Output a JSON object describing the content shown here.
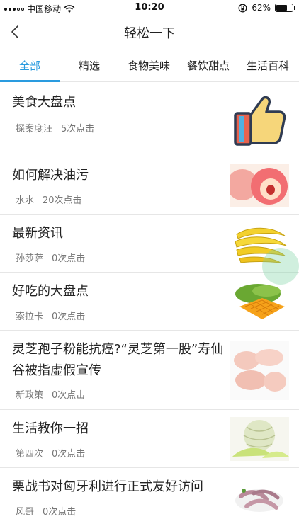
{
  "status": {
    "carrier": "中国移动",
    "time": "10:20",
    "battery": "62%"
  },
  "nav": {
    "title": "轻松一下",
    "back_icon": "chevron-left-icon"
  },
  "tabs": [
    "全部",
    "精选",
    "食物美味",
    "餐饮甜点",
    "生活百科"
  ],
  "active_tab": "全部",
  "colors": {
    "accent": "#2a9bdf",
    "divider": "#e6e6e6",
    "meta": "#777777"
  },
  "articles": [
    {
      "title": "美食大盘点",
      "author": "探案度汪",
      "clicks": "5次点击",
      "thumb": "thumbs-up-icon"
    },
    {
      "title": "如何解决油污",
      "author": "水水",
      "clicks": "20次点击",
      "thumb": "peach-image"
    },
    {
      "title": "最新资讯",
      "author": "孙莎萨",
      "clicks": "0次点击",
      "thumb": "banana-image"
    },
    {
      "title": "好吃的大盘点",
      "author": "索拉卡",
      "clicks": "0次点击",
      "thumb": "mango-image"
    },
    {
      "title": "灵芝孢子粉能抗癌?“灵芝第一股”寿仙谷被指虚假宣传",
      "author": "新政策",
      "clicks": "0次点击",
      "thumb": "chicken-wings-image"
    },
    {
      "title": "生活教你一招",
      "author": "第四次",
      "clicks": "0次点击",
      "thumb": "melon-image"
    },
    {
      "title": "栗战书对匈牙利进行正式友好访问",
      "author": "风哥",
      "clicks": "0次点击",
      "thumb": "shrimp-image"
    }
  ]
}
